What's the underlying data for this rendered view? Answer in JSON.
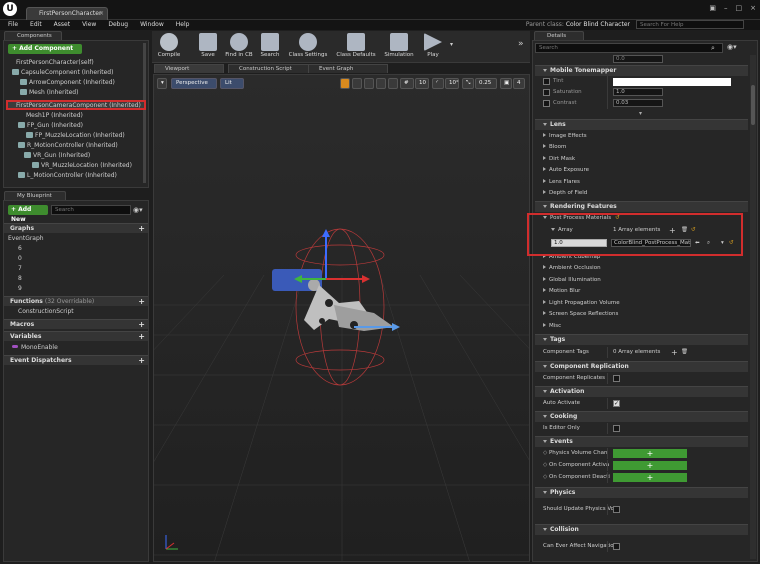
{
  "window": {
    "doc_tab": "FirstPersonCharacter",
    "parent_class_label": "Parent class:",
    "parent_class_value": "Color Blind Character",
    "help_search_placeholder": "Search For Help"
  },
  "menu": [
    "File",
    "Edit",
    "Asset",
    "View",
    "Debug",
    "Window",
    "Help"
  ],
  "components": {
    "tab": "Components",
    "add_button": "+ Add Component",
    "items": [
      {
        "label": "FirstPersonCharacter(self)"
      },
      {
        "label": "CapsuleComponent (Inherited)"
      },
      {
        "label": "ArrowComponent (Inherited)"
      },
      {
        "label": "Mesh (Inherited)"
      },
      {
        "label": "FirstPersonCameraComponent (Inherited)"
      },
      {
        "label": "Mesh1P (Inherited)"
      },
      {
        "label": "FP_Gun (Inherited)"
      },
      {
        "label": "FP_MuzzleLocation (Inherited)"
      },
      {
        "label": "R_MotionController (Inherited)"
      },
      {
        "label": "VR_Gun (Inherited)"
      },
      {
        "label": "VR_MuzzleLocation (Inherited)"
      },
      {
        "label": "L_MotionController (Inherited)"
      }
    ]
  },
  "blueprint": {
    "tab": "My Blueprint",
    "add_new": "+ Add New",
    "search_placeholder": "Search",
    "graphs_label": "Graphs",
    "event_graph": "EventGraph",
    "graph_items": [
      "6",
      "0",
      "7",
      "8",
      "9"
    ],
    "functions_label": "Functions",
    "functions_overridable": "(32 Overridable)",
    "construction_script": "ConstructionScript",
    "macros_label": "Macros",
    "variables_label": "Variables",
    "variable_item": "MonoEnable",
    "dispatchers_label": "Event Dispatchers"
  },
  "toolbar": [
    {
      "label": "Compile"
    },
    {
      "label": "Save"
    },
    {
      "label": "Find in CB"
    },
    {
      "label": "Search"
    },
    {
      "label": "Class Settings"
    },
    {
      "label": "Class Defaults"
    },
    {
      "label": "Simulation"
    },
    {
      "label": "Play"
    }
  ],
  "viewport": {
    "tabs": [
      "Viewport",
      "Construction Script",
      "Event Graph"
    ],
    "perspective": "Perspective",
    "lit": "Lit",
    "grid_snap": "10",
    "rot_snap": "10°",
    "scale_snap": "0.25",
    "cam_speed": "4"
  },
  "details": {
    "tab": "Details",
    "search_placeholder": "Search",
    "top_cut_value": "0.0",
    "sections": {
      "mobile_tonemapper": "Mobile Tonemapper",
      "lens": "Lens",
      "rendering_features": "Rendering Features",
      "tags": "Tags",
      "component_replication": "Component Replication",
      "activation": "Activation",
      "cooking": "Cooking",
      "events": "Events",
      "physics": "Physics",
      "collision": "Collision"
    },
    "tonemapper_rows": [
      {
        "label": "Tint"
      },
      {
        "label": "Saturation",
        "value": "1.0"
      },
      {
        "label": "Contrast",
        "value": "0.03"
      }
    ],
    "lens_items": [
      "Image Effects",
      "Bloom",
      "Dirt Mask",
      "Auto Exposure",
      "Lens Flares",
      "Depth of Field"
    ],
    "pp_materials_label": "Post Process Materials",
    "array_label": "Array",
    "array_count": "1 Array elements",
    "array_weight": "1.0",
    "array_material": "ColorBlind_PostProcess_Mat",
    "render_items": [
      "Ambient Cubemap",
      "Ambient Occlusion",
      "Global Illumination",
      "Motion Blur",
      "Light Propagation Volume",
      "Screen Space Reflections",
      "Misc"
    ],
    "component_tags_label": "Component Tags",
    "component_tags_value": "0 Array elements",
    "component_replicates": "Component Replicates",
    "auto_activate": "Auto Activate",
    "is_editor_only": "Is Editor Only",
    "events": [
      "Physics Volume Chan",
      "On Component Activa",
      "On Component Deacti"
    ],
    "should_update_physics": "Should Update Physics Vo",
    "can_ever_affect_nav": "Can Ever Affect Navigatio"
  }
}
